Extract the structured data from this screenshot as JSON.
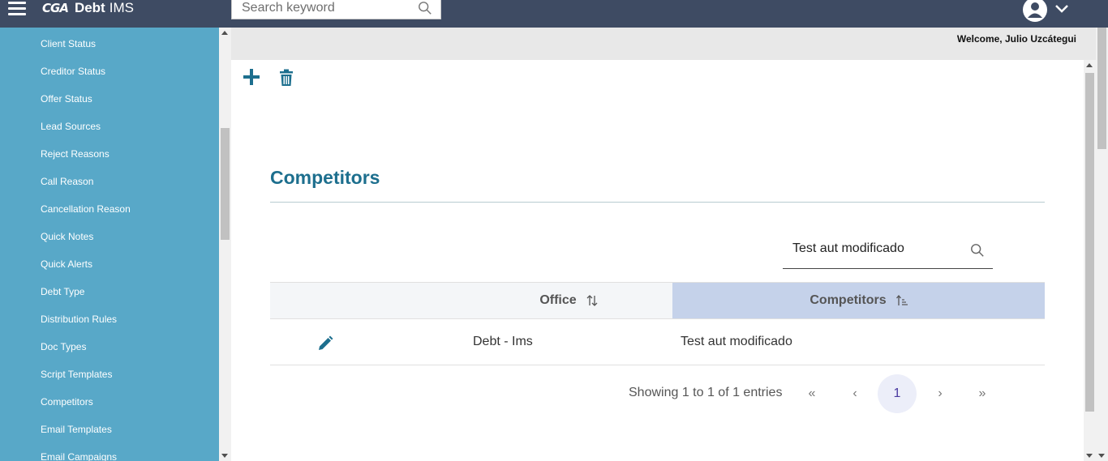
{
  "header": {
    "logo_mark": "CGA",
    "logo_debt": "Debt",
    "logo_ims": "IMS",
    "search_placeholder": "Search keyword"
  },
  "sidebar": {
    "items": [
      {
        "label": "Client Status"
      },
      {
        "label": "Creditor Status"
      },
      {
        "label": "Offer Status"
      },
      {
        "label": "Lead Sources"
      },
      {
        "label": "Reject Reasons"
      },
      {
        "label": "Call Reason"
      },
      {
        "label": "Cancellation Reason"
      },
      {
        "label": "Quick Notes"
      },
      {
        "label": "Quick Alerts"
      },
      {
        "label": "Debt Type"
      },
      {
        "label": "Distribution Rules"
      },
      {
        "label": "Doc Types"
      },
      {
        "label": "Script Templates"
      },
      {
        "label": "Competitors"
      },
      {
        "label": "Email Templates"
      },
      {
        "label": "Email Campaigns"
      }
    ]
  },
  "welcome_text": "Welcome, Julio Uzcátegui",
  "page_title": "Competitors",
  "table": {
    "search_value": "Test aut modificado",
    "headers": {
      "office": "Office",
      "competitors": "Competitors"
    },
    "rows": [
      {
        "office": "Debt - Ims",
        "competitors": "Test aut modificado"
      }
    ]
  },
  "pagination": {
    "info": "Showing 1 to 1 of 1 entries",
    "first": "«",
    "prev": "‹",
    "current": "1",
    "next": "›",
    "last": "»"
  },
  "colors": {
    "topbar": "#3e4b63",
    "sidebar": "#58a8c8",
    "title": "#1d6f8e",
    "sorted_header": "#c5d2ea",
    "action_icons": "#1d6f8e"
  },
  "icons": {
    "menu": "hamburger-icon",
    "search": "search-icon",
    "user": "user-icon",
    "chevron": "chevron-down-icon",
    "add": "plus-icon",
    "delete": "trash-icon",
    "edit": "pencil-icon",
    "sort": "sort-icon"
  }
}
